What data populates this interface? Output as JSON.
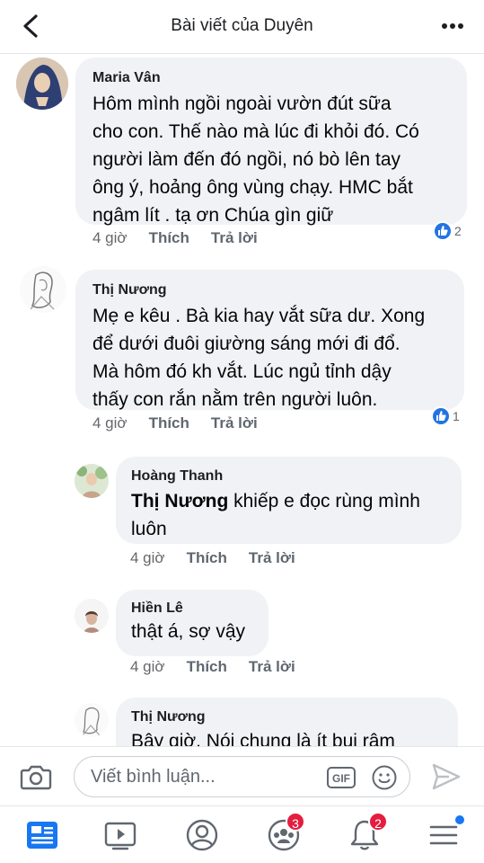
{
  "header": {
    "title": "Bài viết của Duyên"
  },
  "comments": [
    {
      "author": "Maria Vân",
      "lines": [
        "Hôm mình ngồi ngoài vườn đút sữa",
        "cho con. Thế nào mà lúc đi khỏi đó. Có",
        "người làm đến đó ngồi, nó bò lên tay",
        "ông ý, hoảng ông vùng chạy. HMC bắt",
        "ngâm lít . tạ ơn Chúa gìn giữ"
      ],
      "time": "4 giờ",
      "like": "Thích",
      "reply": "Trả lời",
      "reactions": "2"
    },
    {
      "author": "Thị Nương",
      "lines": [
        "Mẹ e kêu . Bà kia hay vắt sữa dư. Xong",
        "để dưới đuôi giường sáng mới đi đổ.",
        "Mà hôm đó kh vắt. Lúc ngủ tỉnh dậy",
        "thấy con rắn nằm trên người luôn."
      ],
      "time": "4 giờ",
      "like": "Thích",
      "reply": "Trả lời",
      "reactions": "1"
    },
    {
      "author": "Hoàng Thanh",
      "mention": "Thị Nương",
      "line1_rest": " khiếp e đọc rùng mình",
      "line2": "luôn",
      "time": "4 giờ",
      "like": "Thích",
      "reply": "Trả lời"
    },
    {
      "author": "Hiền Lê",
      "lines": [
        "thật á, sợ vậy"
      ],
      "time": "4 giờ",
      "like": "Thích",
      "reply": "Trả lời"
    },
    {
      "author": "Thị Nương",
      "lines": [
        "Bây giờ. Nói chung là ít bụi râm"
      ]
    }
  ],
  "composer": {
    "placeholder": "Viết bình luận...",
    "gif_label": "GIF"
  },
  "tabbar": {
    "groups_badge": "3",
    "notifications_badge": "2"
  },
  "colors": {
    "accent": "#1877f2",
    "badge": "#e41e3f",
    "bubble": "#f0f2f5"
  }
}
